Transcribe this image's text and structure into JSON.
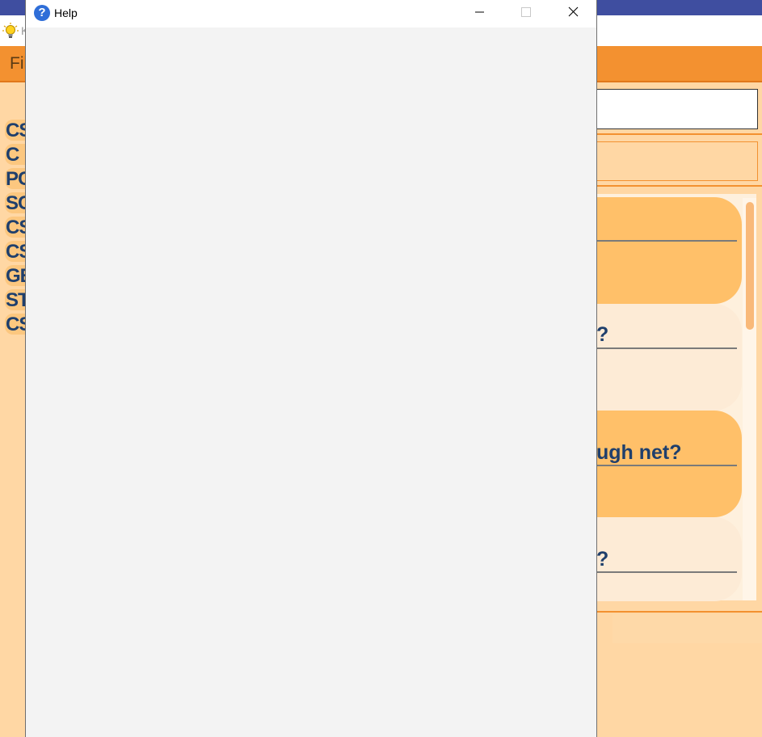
{
  "background_app": {
    "title_fragment": "K",
    "menu_fragment": "Fil",
    "sidebar_items": [
      "CS",
      "C",
      "PC",
      "SC",
      "CS",
      "CS",
      "GE",
      "ST",
      "CS"
    ],
    "questions": [
      {
        "text": "",
        "style": "dark"
      },
      {
        "text": "?",
        "style": "light"
      },
      {
        "text": "ugh net?",
        "style": "dark"
      },
      {
        "text": "?",
        "style": "light"
      }
    ]
  },
  "help_dialog": {
    "title": "Help",
    "icon": "help-question-icon",
    "controls": [
      "minimize",
      "maximize",
      "close"
    ]
  },
  "colors": {
    "orange_accent": "#f39130",
    "peach_background": "#ffd7a4",
    "card_dark": "#ffc069",
    "card_light": "#fdebd6",
    "text_navy": "#1f3f6c",
    "dialog_body": "#f3f3f3"
  }
}
